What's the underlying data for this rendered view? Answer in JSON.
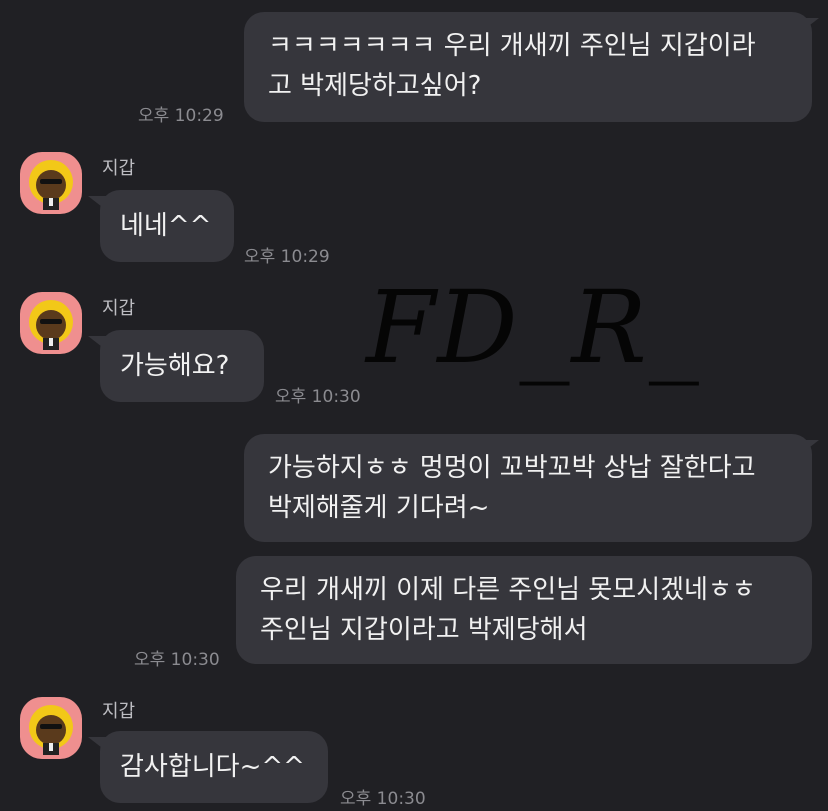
{
  "messages": [
    {
      "text": "ㅋㅋㅋㅋㅋㅋㅋ 우리 개새끼 주인님 지갑이라\n고 박제당하고싶어?",
      "time": "오후 10:29"
    },
    {
      "sender": "지갑",
      "text": "네네^^",
      "time": "오후 10:29"
    },
    {
      "sender": "지갑",
      "text": "가능해요?",
      "time": "오후 10:30"
    },
    {
      "text": "가능하지ㅎㅎ 멍멍이 꼬박꼬박 상납 잘한다고\n박제해줄게 기다려~"
    },
    {
      "text": "우리 개새끼 이제 다른 주인님 못모시겠네ㅎㅎ\n주인님 지갑이라고 박제당해서",
      "time": "오후 10:30"
    },
    {
      "sender": "지갑",
      "text": "감사합니다~^^",
      "time": "오후 10:30"
    }
  ],
  "watermark": "FD_R_",
  "colors": {
    "background": "#202024",
    "bubble": "#36363c",
    "avatar_bg": "#ef8f8f",
    "avatar_hair": "#f2c818",
    "avatar_face": "#5a3a1c"
  }
}
